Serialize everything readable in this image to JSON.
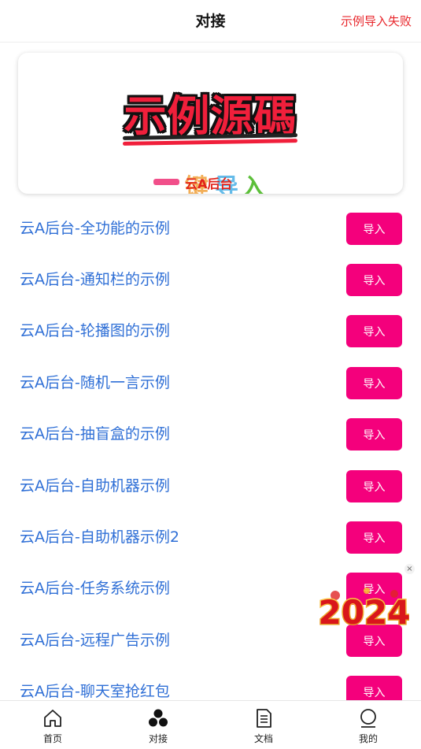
{
  "header": {
    "title": "对接",
    "right_status": "示例导入失败"
  },
  "banner": {
    "headline": "示例源碼",
    "sub_chars": [
      "键",
      "导",
      "入"
    ],
    "overlay": "云A后台"
  },
  "list": {
    "items": [
      {
        "label": "云A后台-全功能的示例",
        "button": "导入"
      },
      {
        "label": "云A后台-通知栏的示例",
        "button": "导入"
      },
      {
        "label": "云A后台-轮播图的示例",
        "button": "导入"
      },
      {
        "label": "云A后台-随机一言示例",
        "button": "导入"
      },
      {
        "label": "云A后台-抽盲盒的示例",
        "button": "导入"
      },
      {
        "label": "云A后台-自助机器示例",
        "button": "导入"
      },
      {
        "label": "云A后台-自助机器示例2",
        "button": "导入"
      },
      {
        "label": "云A后台-任务系统示例",
        "button": "导入"
      },
      {
        "label": "云A后台-远程广告示例",
        "button": "导入"
      },
      {
        "label": "云A后台-聊天室抢红包",
        "button": "导入"
      }
    ]
  },
  "floating": {
    "close": "×",
    "badge": "2024"
  },
  "tabbar": {
    "tabs": [
      {
        "label": "首页",
        "icon": "home-icon"
      },
      {
        "label": "对接",
        "icon": "cluster-icon"
      },
      {
        "label": "文档",
        "icon": "document-icon"
      },
      {
        "label": "我的",
        "icon": "profile-icon"
      }
    ]
  },
  "colors": {
    "accent": "#f4007c",
    "link_text": "#2f6fd6",
    "error_text": "#e8262b"
  }
}
